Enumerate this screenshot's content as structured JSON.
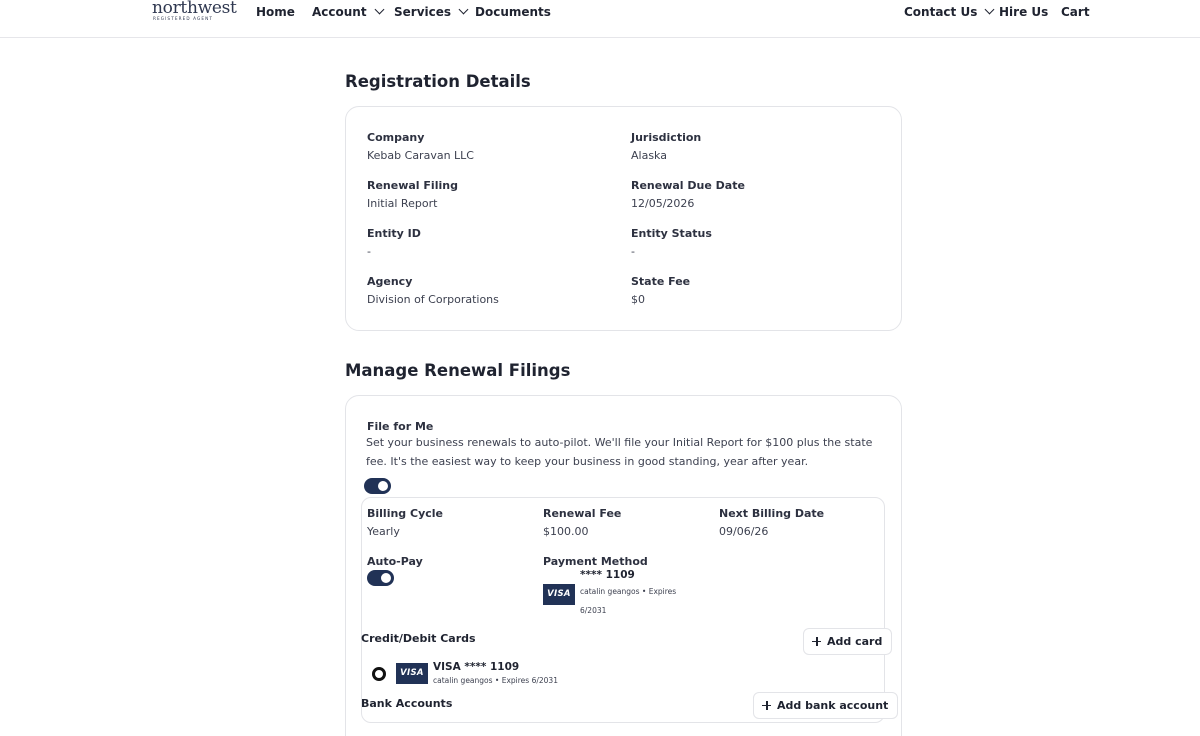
{
  "header": {
    "logo_text": "northwest",
    "logo_subtext": "REGISTERED AGENT",
    "nav": {
      "home": "Home",
      "account": "Account",
      "services": "Services",
      "documents": "Documents",
      "contact_us": "Contact Us",
      "hire_us": "Hire Us",
      "cart": "Cart"
    }
  },
  "registration": {
    "title": "Registration Details",
    "company": {
      "label": "Company",
      "value": "Kebab Caravan LLC"
    },
    "jurisdiction": {
      "label": "Jurisdiction",
      "value": "Alaska"
    },
    "renewal_filing": {
      "label": "Renewal Filing",
      "value": "Initial Report"
    },
    "renewal_due_date": {
      "label": "Renewal Due Date",
      "value": "12/05/2026"
    },
    "entity_id": {
      "label": "Entity ID",
      "value": "-"
    },
    "entity_status": {
      "label": "Entity Status",
      "value": "-"
    },
    "agency": {
      "label": "Agency",
      "value": "Division of Corporations"
    },
    "state_fee": {
      "label": "State Fee",
      "value": "$0"
    }
  },
  "renewal": {
    "title": "Manage Renewal Filings",
    "file_for_me": {
      "label": "File for Me",
      "description": "Set your business renewals to auto-pilot. We'll file your Initial Report for $100 plus the state fee. It's the easiest way to keep your business in good standing, year after year.",
      "enabled": true
    },
    "billing_cycle": {
      "label": "Billing Cycle",
      "value": "Yearly"
    },
    "renewal_fee": {
      "label": "Renewal Fee",
      "value": "$100.00"
    },
    "next_billing_date": {
      "label": "Next Billing Date",
      "value": "09/06/26"
    },
    "auto_pay": {
      "label": "Auto-Pay",
      "enabled": true
    },
    "payment_method": {
      "label": "Payment Method",
      "brand": "VISA",
      "masked": "**** 1109",
      "holder_expiry": "catalin geangos • Expires",
      "expiry": "6/2031"
    },
    "cards": {
      "heading": "Credit/Debit Cards",
      "add_label": "Add card",
      "items": [
        {
          "brand": "VISA",
          "title": "VISA **** 1109",
          "detail": "catalin geangos • Expires 6/2031",
          "selected": true
        }
      ]
    },
    "bank": {
      "heading": "Bank Accounts",
      "add_label": "Add bank account"
    }
  },
  "colors": {
    "accent": "#213256",
    "text": "#1f2330",
    "border": "#e3e4e8"
  }
}
